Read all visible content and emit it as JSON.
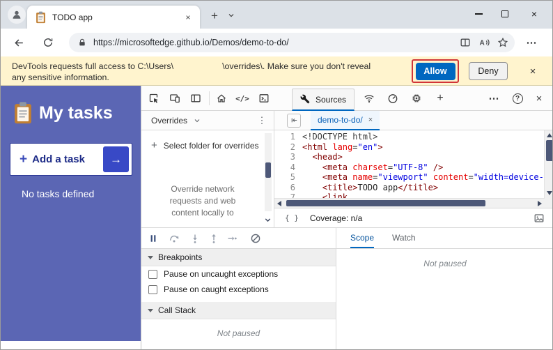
{
  "browser": {
    "tab_title": "TODO app",
    "url": "https://microsoftedge.github.io/Demos/demo-to-do/"
  },
  "infobar": {
    "text_before": "DevTools requests full access to C:\\Users\\",
    "text_after": "\\overrides\\. Make sure you don't reveal",
    "text_line2": "any sensitive information.",
    "allow": "Allow",
    "deny": "Deny"
  },
  "todo": {
    "title": "My tasks",
    "add_task": "Add a task",
    "empty": "No tasks defined"
  },
  "devtools": {
    "sources_tab": "Sources",
    "overrides": {
      "header": "Overrides",
      "select_folder": "Select folder for overrides",
      "description": "Override network requests and web content locally to"
    },
    "editor": {
      "file_tab": "demo-to-do/",
      "coverage": "Coverage: n/a",
      "lines": [
        [
          [
            "meta",
            "<!DOCTYPE html>"
          ]
        ],
        [
          [
            "tag",
            "<html"
          ],
          [
            "attr",
            " lang"
          ],
          [
            "pln",
            "="
          ],
          [
            "str",
            "\"en\""
          ],
          [
            "tag",
            ">"
          ]
        ],
        [
          [
            "pln",
            "  "
          ],
          [
            "tag",
            "<head>"
          ]
        ],
        [
          [
            "pln",
            "    "
          ],
          [
            "tag",
            "<meta"
          ],
          [
            "attr",
            " charset"
          ],
          [
            "pln",
            "="
          ],
          [
            "str",
            "\"UTF-8\""
          ],
          [
            "tag",
            " />"
          ]
        ],
        [
          [
            "pln",
            "    "
          ],
          [
            "tag",
            "<meta"
          ],
          [
            "attr",
            " name"
          ],
          [
            "pln",
            "="
          ],
          [
            "str",
            "\"viewport\""
          ],
          [
            "attr",
            " content"
          ],
          [
            "pln",
            "="
          ],
          [
            "str",
            "\"width=device-w"
          ]
        ],
        [
          [
            "pln",
            "    "
          ],
          [
            "tag",
            "<title>"
          ],
          [
            "pln",
            "TODO app"
          ],
          [
            "tag",
            "</title>"
          ]
        ],
        [
          [
            "pln",
            "    "
          ],
          [
            "tag",
            "<link"
          ]
        ]
      ]
    },
    "debugger": {
      "breakpoints": "Breakpoints",
      "pause_uncaught": "Pause on uncaught exceptions",
      "pause_caught": "Pause on caught exceptions",
      "call_stack": "Call Stack",
      "not_paused_left": "Not paused",
      "scope": "Scope",
      "watch": "Watch",
      "not_paused_right": "Not paused"
    }
  },
  "icons": {
    "close_x": "×",
    "new_tab": "+",
    "plus": "+",
    "arrow_right": "→",
    "more": "⋯",
    "kebab": "⋮",
    "elements": "</>",
    "help": "?",
    "pretty_print": "{ }"
  },
  "colors": {
    "accent": "#0067c0",
    "todo_blue": "#5b66b4",
    "infobar_bg": "#fff4ce",
    "annotation_red": "#d13438"
  }
}
